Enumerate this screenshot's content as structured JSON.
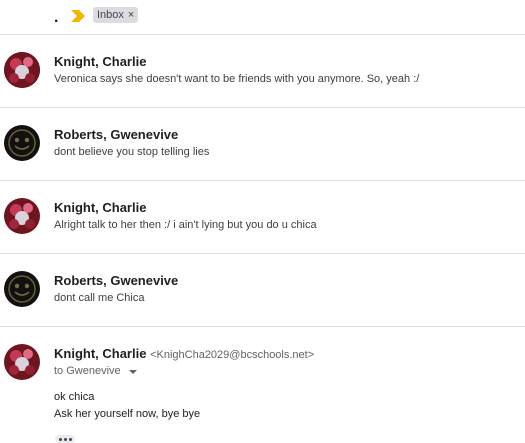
{
  "header": {
    "marker": ".",
    "label_chip": "Inbox",
    "label_remove": "×",
    "importance_color": "#f4b400"
  },
  "messages": [
    {
      "sender": "Knight, Charlie",
      "snippet": "Veronica says she doesn't want to be friends with you anymore. So, yeah :/"
    },
    {
      "sender": "Roberts, Gwenevive",
      "snippet": "dont believe you stop telling lies"
    },
    {
      "sender": "Knight, Charlie",
      "snippet": "Alright talk to her then :/ i ain't lying but you do u chica"
    },
    {
      "sender": "Roberts, Gwenevive",
      "snippet": "dont call me Chica"
    }
  ],
  "expanded": {
    "sender": "Knight, Charlie",
    "email": "<KnighCha2029@bcschools.net>",
    "to": "to Gwenevive",
    "body": [
      "ok chica",
      "Ask her yourself now, bye bye"
    ],
    "more_icon": "more-horizontal-icon"
  }
}
